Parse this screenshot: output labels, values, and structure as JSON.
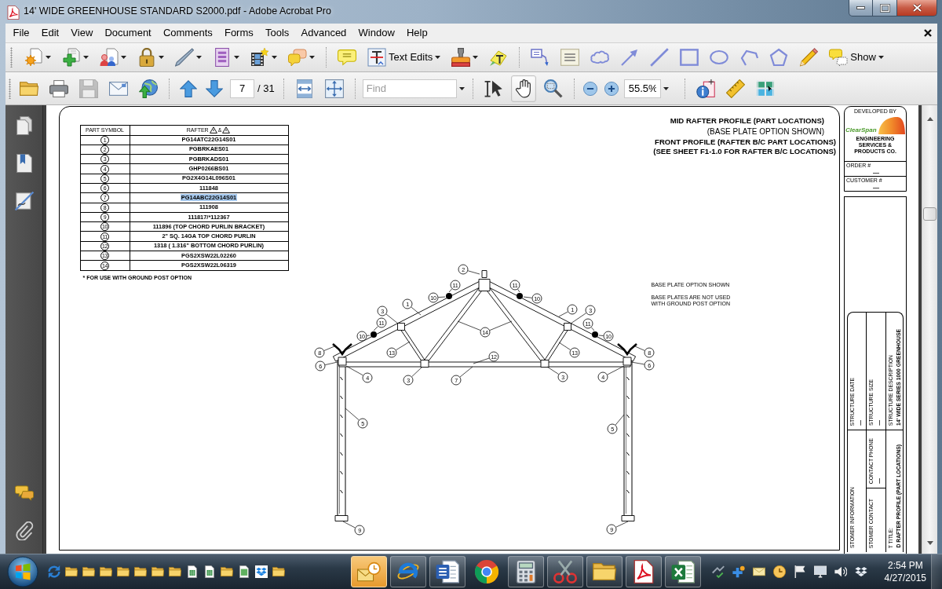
{
  "window": {
    "title": "14' WIDE GREENHOUSE STANDARD S2000.pdf - Adobe Acrobat Pro"
  },
  "menu": [
    "File",
    "Edit",
    "View",
    "Document",
    "Comments",
    "Forms",
    "Tools",
    "Advanced",
    "Window",
    "Help"
  ],
  "toolbar_1": [
    {
      "kind": "dropdown"
    },
    {
      "kind": "dropdown"
    },
    {
      "kind": "dropdown"
    },
    {
      "kind": "dropdown"
    },
    {
      "kind": "dropdown"
    },
    {
      "kind": "dropdown"
    },
    {
      "kind": "dropdown"
    },
    {
      "kind": "dropdown"
    },
    {
      "kind": "separator"
    },
    {
      "kind": "button"
    },
    {
      "kind": "dropdown",
      "label": "Text Edits"
    },
    {
      "kind": "dropdown"
    },
    {
      "kind": "button"
    },
    {
      "kind": "separator"
    },
    {
      "kind": "button"
    },
    {
      "kind": "button"
    },
    {
      "kind": "button"
    },
    {
      "kind": "button"
    },
    {
      "kind": "button"
    },
    {
      "kind": "button"
    },
    {
      "kind": "button"
    },
    {
      "kind": "button"
    },
    {
      "kind": "button"
    },
    {
      "kind": "button"
    },
    {
      "kind": "dropdown",
      "label": "Show"
    }
  ],
  "toolbar_2": [
    {
      "kind": "tool",
      "selected": false,
      "disabled": false
    },
    {
      "kind": "tool",
      "selected": false,
      "disabled": false
    },
    {
      "kind": "tool",
      "selected": false,
      "disabled": true
    },
    {
      "kind": "tool",
      "selected": false,
      "disabled": false
    },
    {
      "kind": "tool",
      "selected": false,
      "disabled": false
    },
    {
      "kind": "separator"
    },
    {
      "kind": "tool",
      "selected": false,
      "disabled": false
    },
    {
      "kind": "tool",
      "selected": false,
      "disabled": false
    },
    {
      "kind": "pager",
      "value": "7",
      "total": "/ 31"
    },
    {
      "kind": "separator"
    },
    {
      "kind": "tool",
      "selected": false,
      "disabled": false
    },
    {
      "kind": "tool",
      "selected": false,
      "disabled": false
    },
    {
      "kind": "separator"
    },
    {
      "kind": "find",
      "placeholder": "Find"
    },
    {
      "kind": "separator"
    },
    {
      "kind": "tool",
      "selected": false,
      "disabled": false
    },
    {
      "kind": "tool",
      "selected": true,
      "disabled": false
    },
    {
      "kind": "tool",
      "selected": false,
      "disabled": false
    },
    {
      "kind": "separator"
    },
    {
      "kind": "tool",
      "selected": false,
      "disabled": false
    },
    {
      "kind": "tool",
      "selected": false,
      "disabled": false
    },
    {
      "kind": "zoom",
      "value": "55.5%"
    },
    {
      "kind": "separator"
    },
    {
      "kind": "tool",
      "selected": false,
      "disabled": false
    },
    {
      "kind": "tool",
      "selected": false,
      "disabled": false
    },
    {
      "kind": "tool",
      "selected": false,
      "disabled": false
    }
  ],
  "document": {
    "parts_table": {
      "columns": [
        "PART SYMBOL",
        "RAFTER"
      ],
      "column_joiner": "&",
      "rows": [
        {
          "symbol": "1",
          "part": "PG14ATC22G14S01",
          "selected": false
        },
        {
          "symbol": "2",
          "part": "PGBRKAES01",
          "selected": false
        },
        {
          "symbol": "3",
          "part": "PGBRKADS01",
          "selected": false
        },
        {
          "symbol": "4",
          "part": "GHP0266BS01",
          "selected": false
        },
        {
          "symbol": "5",
          "part": "PG2X4G14L096S01",
          "selected": false
        },
        {
          "symbol": "6",
          "part": "111848",
          "selected": false
        },
        {
          "symbol": "7",
          "part": "PG14ABC22G14S01",
          "selected": true
        },
        {
          "symbol": "8",
          "part": "111908",
          "selected": false
        },
        {
          "symbol": "9",
          "part": "111817/*112367",
          "selected": false
        },
        {
          "symbol": "10",
          "part": "111896 (TOP CHORD PURLIN BRACKET)",
          "selected": false
        },
        {
          "symbol": "11",
          "part": "2\" SQ. 14GA TOP CHORD PURLIN",
          "selected": false
        },
        {
          "symbol": "12",
          "part": "1318 ( 1.316\" BOTTOM CHORD PURLIN)",
          "selected": false
        },
        {
          "symbol": "13",
          "part": "PGS2XSW22L02260",
          "selected": false
        },
        {
          "symbol": "14",
          "part": "PGS2XSW22L06319",
          "selected": false
        }
      ],
      "footnote": "* FOR USE WITH GROUND POST OPTION"
    },
    "headings": [
      {
        "lines": [
          {
            "text": "MID RAFTER PROFILE (PART LOCATIONS)",
            "kind": "title"
          },
          {
            "text": "(BASE PLATE OPTION SHOWN)",
            "kind": "subtitle"
          }
        ]
      },
      {
        "lines": [
          {
            "text": "FRONT PROFILE (RAFTER B/C PART LOCATIONS)",
            "kind": "title"
          },
          {
            "text": "(SEE SHEET F1-1.0 FOR RAFTER B/C LOCATIONS)",
            "kind": "title"
          }
        ]
      }
    ],
    "notes": [
      "BASE PLATE OPTION SHOWN",
      "BASE PLATES ARE NOT USED WITH GROUND POST OPTION"
    ],
    "callouts": [
      "2",
      "11",
      "11",
      "10",
      "10",
      "1",
      "3",
      "1",
      "3",
      "11",
      "11",
      "14",
      "10",
      "10",
      "8",
      "13",
      "13",
      "8",
      "12",
      "6",
      "6",
      "4",
      "3",
      "7",
      "3",
      "4",
      "5",
      "5",
      "9",
      "9"
    ],
    "title_block": {
      "caption": "DEVELOPED BY",
      "logo": "ClearSpan",
      "company_lines": [
        "ENGINEERING SERVICES & PRODUCTS CO."
      ],
      "fields": [
        {
          "label": "ORDER #",
          "value": "—"
        },
        {
          "label": "CUSTOMER #",
          "value": "—"
        }
      ],
      "sheet_info": [
        [
          {
            "label": "STRUCTURE DATE",
            "value": "—"
          },
          {
            "label": "STOMER INFORMATION"
          }
        ],
        [
          {
            "label": "STRUCTURE SIZE",
            "value": "—"
          },
          {
            "label": "CONTACT PHONE",
            "value": "—"
          },
          {
            "label": "STOMER CONTACT"
          }
        ],
        [
          {
            "label": "STRUCTURE DESCRIPTION",
            "value": "14' WIDE SERIES 1000 GREENHOUSE"
          },
          {
            "label": "T TITLE:",
            "value": "D RAFTER PROFILE (PART LOCATIONS)"
          }
        ]
      ]
    }
  },
  "taskbar": {
    "pinned": [
      {
        "running": true,
        "attention": true
      },
      {
        "running": true,
        "attention": false
      },
      {
        "running": true,
        "attention": false
      },
      {
        "running": false,
        "attention": false
      },
      {
        "running": true,
        "attention": false
      },
      {
        "running": true,
        "attention": false
      },
      {
        "running": true,
        "attention": false
      },
      {
        "running": true,
        "attention": false
      },
      {
        "running": true,
        "attention": false
      }
    ],
    "clock": {
      "time": "2:54 PM",
      "date": "4/27/2015"
    }
  }
}
